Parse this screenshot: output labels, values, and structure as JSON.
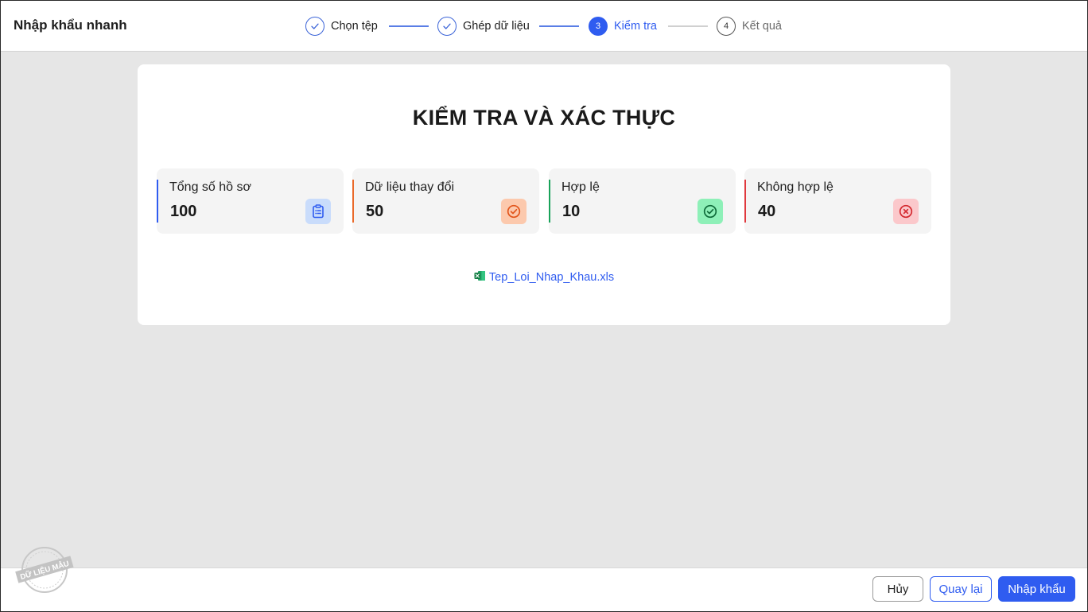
{
  "header": {
    "title": "Nhập khẩu nhanh",
    "steps": [
      {
        "label": "Chọn tệp",
        "state": "done",
        "number": ""
      },
      {
        "label": "Ghép dữ liệu",
        "state": "done",
        "number": ""
      },
      {
        "label": "Kiểm tra",
        "state": "active",
        "number": "3"
      },
      {
        "label": "Kết quả",
        "state": "todo",
        "number": "4"
      }
    ]
  },
  "main": {
    "title": "KIỂM TRA VÀ XÁC THỰC",
    "stats": [
      {
        "label": "Tổng số hồ sơ",
        "value": "100",
        "accent": "#2f5cf0",
        "icon": "clipboard-list-icon"
      },
      {
        "label": "Dữ liệu thay đổi",
        "value": "50",
        "accent": "#ea6a2a",
        "icon": "check-circle-orange-icon"
      },
      {
        "label": "Hợp lệ",
        "value": "10",
        "accent": "#19a35a",
        "icon": "check-circle-green-icon"
      },
      {
        "label": "Không hợp lệ",
        "value": "40",
        "accent": "#e0393e",
        "icon": "x-circle-icon"
      }
    ],
    "error_file": {
      "name": "Tep_Loi_Nhap_Khau.xls",
      "icon": "excel-file-icon"
    }
  },
  "footer": {
    "cancel_label": "Hủy",
    "back_label": "Quay lại",
    "import_label": "Nhập khẩu"
  },
  "watermark": {
    "text": "DỮ LIỆU MẪU"
  },
  "colors": {
    "primary": "#2f5cf0",
    "background": "#e6e6e6"
  }
}
